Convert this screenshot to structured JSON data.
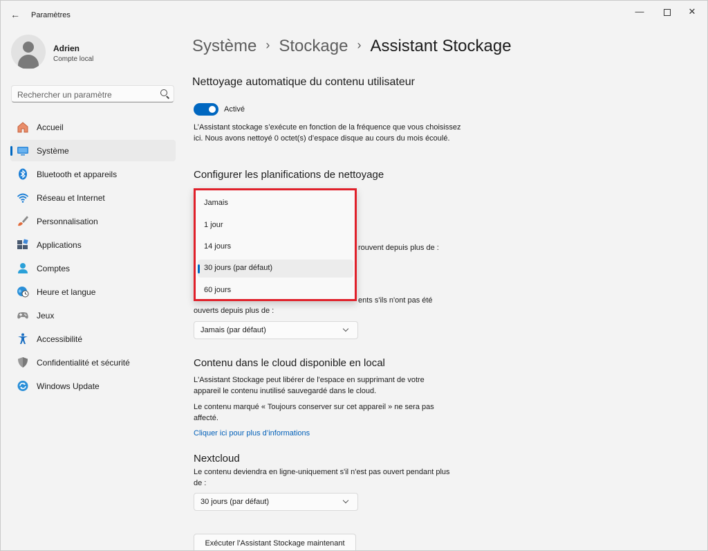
{
  "window": {
    "title": "Paramètres",
    "minimize": "—",
    "close": "✕",
    "back": "←"
  },
  "user": {
    "name": "Adrien",
    "account": "Compte local"
  },
  "search": {
    "placeholder": "Rechercher un paramètre"
  },
  "nav": [
    {
      "label": "Accueil",
      "icon": "home-icon",
      "color": "#e07050"
    },
    {
      "label": "Système",
      "icon": "system-icon",
      "color": "#2b87d8",
      "active": true
    },
    {
      "label": "Bluetooth et appareils",
      "icon": "bluetooth-icon",
      "color": "#1c7fd6"
    },
    {
      "label": "Réseau et Internet",
      "icon": "wifi-icon",
      "color": "#1c7fd6"
    },
    {
      "label": "Personnalisation",
      "icon": "brush-icon",
      "color": "#e26a3a"
    },
    {
      "label": "Applications",
      "icon": "apps-icon",
      "color": "#4a5a70"
    },
    {
      "label": "Comptes",
      "icon": "person-icon",
      "color": "#2aa0d8"
    },
    {
      "label": "Heure et langue",
      "icon": "globe-clock-icon",
      "color": "#2a8fd8"
    },
    {
      "label": "Jeux",
      "icon": "gamepad-icon",
      "color": "#7a7a7a"
    },
    {
      "label": "Accessibilité",
      "icon": "accessibility-icon",
      "color": "#1b6fc2"
    },
    {
      "label": "Confidentialité et sécurité",
      "icon": "shield-icon",
      "color": "#8a8a8a"
    },
    {
      "label": "Windows Update",
      "icon": "update-icon",
      "color": "#2a8fd8"
    }
  ],
  "breadcrumb": {
    "level1": "Système",
    "level2": "Stockage",
    "current": "Assistant Stockage",
    "separator": "›"
  },
  "auto_cleanup": {
    "title": "Nettoyage automatique du contenu utilisateur",
    "toggle_state": "Activé",
    "description": "L’Assistant stockage s’exécute en fonction de la fréquence que vous choisissez ici. Nous avons nettoyé 0 octet(s) d’espace disque au cours du mois écoulé."
  },
  "schedule": {
    "title": "Configurer les planifications de nettoyage",
    "partial_text_1": "rouvent depuis plus de :",
    "partial_text_2": "ents s'ils n'ont pas été",
    "downloads_label_end": "ouverts depuis plus de :",
    "downloads_value": "Jamais (par défaut)"
  },
  "popup": {
    "options": [
      "Jamais",
      "1 jour",
      "14 jours",
      "30 jours (par défaut)",
      "60 jours"
    ],
    "selected_index": 3
  },
  "cloud": {
    "title": "Contenu dans le cloud disponible en local",
    "description": "L'Assistant Stockage peut libérer de l'espace en supprimant de votre appareil le contenu inutilisé sauvegardé dans le cloud.",
    "note": "Le contenu marqué « Toujours conserver sur cet appareil » ne sera pas affecté.",
    "link": "Cliquer ici pour plus d’informations"
  },
  "nextcloud": {
    "title": "Nextcloud",
    "description": "Le contenu deviendra en ligne-uniquement s'il n'est pas ouvert pendant plus de :",
    "value": "30 jours (par défaut)"
  },
  "run_button": "Exécuter l'Assistant Stockage maintenant"
}
